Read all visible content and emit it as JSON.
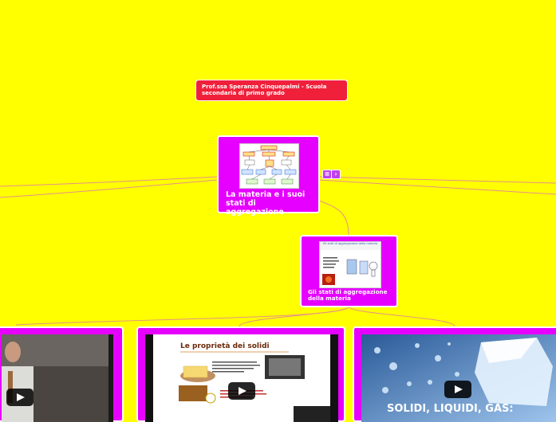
{
  "colors": {
    "background": "#ffff00",
    "central_node": "#e600ff",
    "header_node": "#f0203a",
    "connector": "#e8908a"
  },
  "header_node": {
    "text": "Prof.ssa Speranza Cinquepalmi  - Scuola secondaria di primo grado"
  },
  "central_node": {
    "label": "La materia e i suoi stati di aggregazione",
    "image_icon": "concept-map-thumbnail",
    "action_icons": [
      "notes-icon",
      "collapse-icon"
    ]
  },
  "sub_node": {
    "label": "Gli stati di aggregazione della materia",
    "image_icon": "states-of-matter-thumbnail",
    "thumbnail_title": "Gli stati di aggregazione della materia"
  },
  "video_nodes": [
    {
      "name": "video-teacher",
      "icon": "play-icon",
      "caption": ""
    },
    {
      "name": "video-solids",
      "icon": "play-icon",
      "caption": "Le proprietà dei solidi"
    },
    {
      "name": "video-states",
      "icon": "play-icon",
      "caption": "SOLIDI, LIQUIDI, GAS:"
    }
  ]
}
